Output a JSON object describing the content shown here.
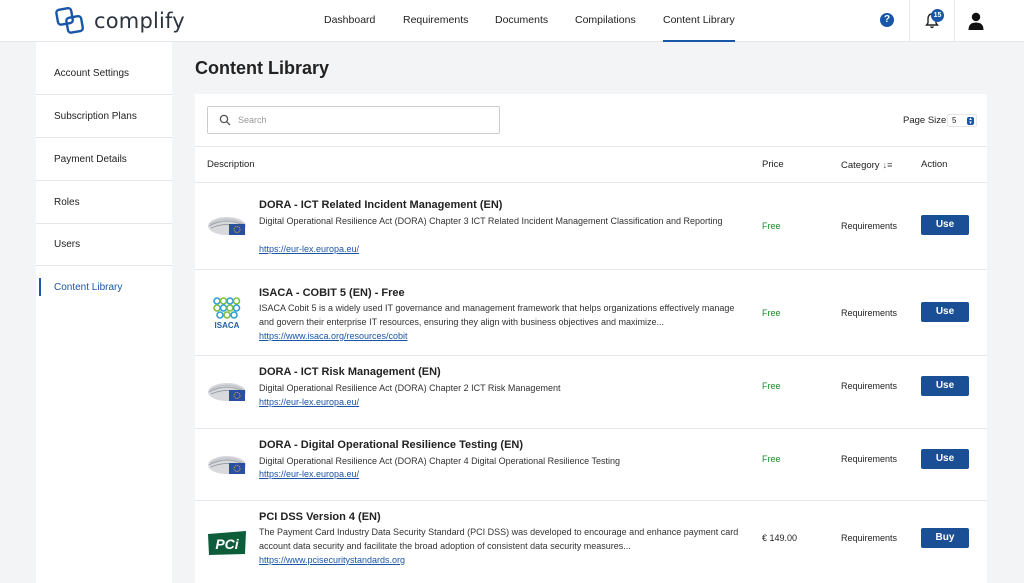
{
  "app": {
    "name": "complify",
    "brand_color": "#1a56a8"
  },
  "header": {
    "nav": [
      "Dashboard",
      "Requirements",
      "Documents",
      "Compilations",
      "Content Library"
    ],
    "active_nav": "Content Library",
    "help_icon": "question-icon",
    "notification_count": "15"
  },
  "sidebar": {
    "items": [
      "Account Settings",
      "Subscription Plans",
      "Payment Details",
      "Roles",
      "Users",
      "Content Library"
    ],
    "active": "Content Library"
  },
  "main": {
    "title": "Content Library",
    "search": {
      "placeholder": "Search",
      "value": ""
    },
    "page_size": {
      "label": "Page Size",
      "value": "5"
    },
    "table": {
      "headers": [
        "Description",
        "Price",
        "Category",
        "Action"
      ],
      "rows": [
        {
          "logo": "eu-parliament-logo",
          "title": "DORA - ICT Related Incident Management (EN)",
          "description": "Digital Operational Resilience Act (DORA) Chapter 3 ICT Related Incident Management Classification and Reporting",
          "link": "https://eur-lex.europa.eu/",
          "price": "Free",
          "category": "Requirements",
          "action": "Use"
        },
        {
          "logo": "isaca-logo",
          "title": "ISACA - COBIT 5 (EN) - Free",
          "description": "ISACA Cobit 5 is a widely used IT governance and management framework that helps organizations effectively manage and govern their enterprise IT resources, ensuring they align with business objectives and maximize...",
          "link": "https://www.isaca.org/resources/cobit",
          "price": "Free",
          "category": "Requirements",
          "action": "Use"
        },
        {
          "logo": "eu-parliament-logo",
          "title": "DORA - ICT Risk Management (EN)",
          "description": "Digital Operational Resilience Act (DORA) Chapter 2 ICT Risk Management",
          "link": "https://eur-lex.europa.eu/",
          "price": "Free",
          "category": "Requirements",
          "action": "Use"
        },
        {
          "logo": "eu-parliament-logo",
          "title": "DORA - Digital Operational Resilience Testing (EN)",
          "description": "Digital Operational Resilience Act (DORA) Chapter 4 Digital Operational Resilience Testing",
          "link": "https://eur-lex.europa.eu/",
          "price": "Free",
          "category": "Requirements",
          "action": "Use"
        },
        {
          "logo": "pci-logo",
          "logo_text": "PCi",
          "title": "PCI DSS Version 4 (EN)",
          "description": "The Payment Card Industry Data Security Standard (PCI DSS) was developed to encourage and enhance payment card account data security and facilitate the broad adoption of consistent data security measures...",
          "link": "https://www.pcisecuritystandards.org",
          "price": "€ 149.00",
          "category": "Requirements",
          "action": "Buy"
        }
      ]
    }
  },
  "colors": {
    "free": "#1d8a2e",
    "button": "#1a4f96",
    "link": "#1a56a8"
  }
}
